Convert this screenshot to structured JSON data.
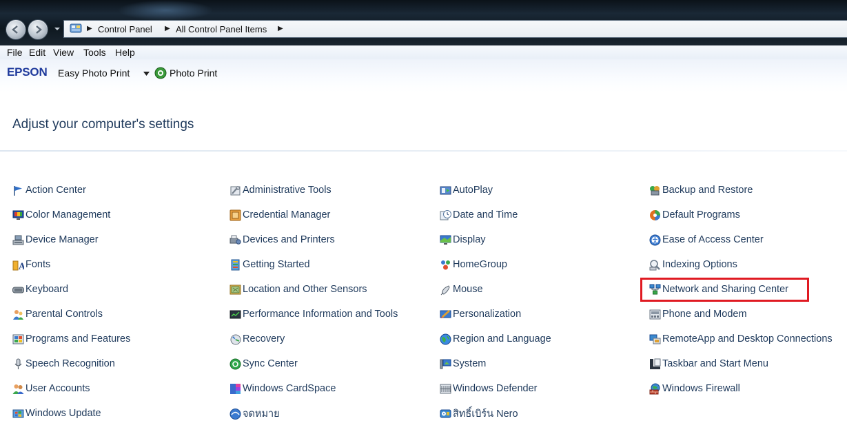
{
  "window": {
    "breadcrumbs": [
      "Control Panel",
      "All Control Panel Items"
    ]
  },
  "menu": {
    "items": [
      "File",
      "Edit",
      "View",
      "Tools",
      "Help"
    ]
  },
  "toolbar": {
    "logo": "EPSON",
    "easy_photo_print": "Easy Photo Print",
    "photo_print": "Photo Print"
  },
  "main": {
    "heading": "Adjust your computer's settings",
    "highlighted_item": "Network and Sharing Center",
    "highlight_color": "#e01a22",
    "columns": [
      {
        "items": [
          {
            "label": "Action Center",
            "icon": "flag-icon"
          },
          {
            "label": "Color Management",
            "icon": "monitor-icon"
          },
          {
            "label": "Device Manager",
            "icon": "device-manager-icon"
          },
          {
            "label": "Fonts",
            "icon": "fonts-icon"
          },
          {
            "label": "Keyboard",
            "icon": "keyboard-icon"
          },
          {
            "label": "Parental Controls",
            "icon": "parental-controls-icon"
          },
          {
            "label": "Programs and Features",
            "icon": "programs-icon"
          },
          {
            "label": "Speech Recognition",
            "icon": "microphone-icon"
          },
          {
            "label": "User Accounts",
            "icon": "users-icon"
          },
          {
            "label": "Windows Update",
            "icon": "windows-update-icon"
          }
        ]
      },
      {
        "items": [
          {
            "label": "Administrative Tools",
            "icon": "admin-tools-icon"
          },
          {
            "label": "Credential Manager",
            "icon": "credential-icon"
          },
          {
            "label": "Devices and Printers",
            "icon": "printer-icon"
          },
          {
            "label": "Getting Started",
            "icon": "getting-started-icon"
          },
          {
            "label": "Location and Other Sensors",
            "icon": "sensors-icon"
          },
          {
            "label": "Performance Information and Tools",
            "icon": "performance-icon"
          },
          {
            "label": "Recovery",
            "icon": "recovery-icon"
          },
          {
            "label": "Sync Center",
            "icon": "sync-icon"
          },
          {
            "label": "Windows CardSpace",
            "icon": "cardspace-icon"
          },
          {
            "label": "จดหมาย",
            "icon": "mail-icon"
          }
        ]
      },
      {
        "items": [
          {
            "label": "AutoPlay",
            "icon": "autoplay-icon"
          },
          {
            "label": "Date and Time",
            "icon": "clock-icon"
          },
          {
            "label": "Display",
            "icon": "display-icon"
          },
          {
            "label": "HomeGroup",
            "icon": "homegroup-icon"
          },
          {
            "label": "Mouse",
            "icon": "mouse-icon"
          },
          {
            "label": "Personalization",
            "icon": "personalization-icon"
          },
          {
            "label": "Region and Language",
            "icon": "globe-icon"
          },
          {
            "label": "System",
            "icon": "system-icon"
          },
          {
            "label": "Windows Defender",
            "icon": "defender-icon"
          },
          {
            "label": "สิทธิ์เบิร์น Nero",
            "icon": "nero-icon"
          }
        ]
      },
      {
        "items": [
          {
            "label": "Backup and Restore",
            "icon": "backup-icon"
          },
          {
            "label": "Default Programs",
            "icon": "default-programs-icon"
          },
          {
            "label": "Ease of Access Center",
            "icon": "ease-of-access-icon"
          },
          {
            "label": "Indexing Options",
            "icon": "indexing-icon"
          },
          {
            "label": "Network and Sharing Center",
            "icon": "network-icon"
          },
          {
            "label": "Phone and Modem",
            "icon": "phone-icon"
          },
          {
            "label": "RemoteApp and Desktop Connections",
            "icon": "remoteapp-icon"
          },
          {
            "label": "Taskbar and Start Menu",
            "icon": "taskbar-icon"
          },
          {
            "label": "Windows Firewall",
            "icon": "firewall-icon"
          }
        ]
      }
    ]
  }
}
